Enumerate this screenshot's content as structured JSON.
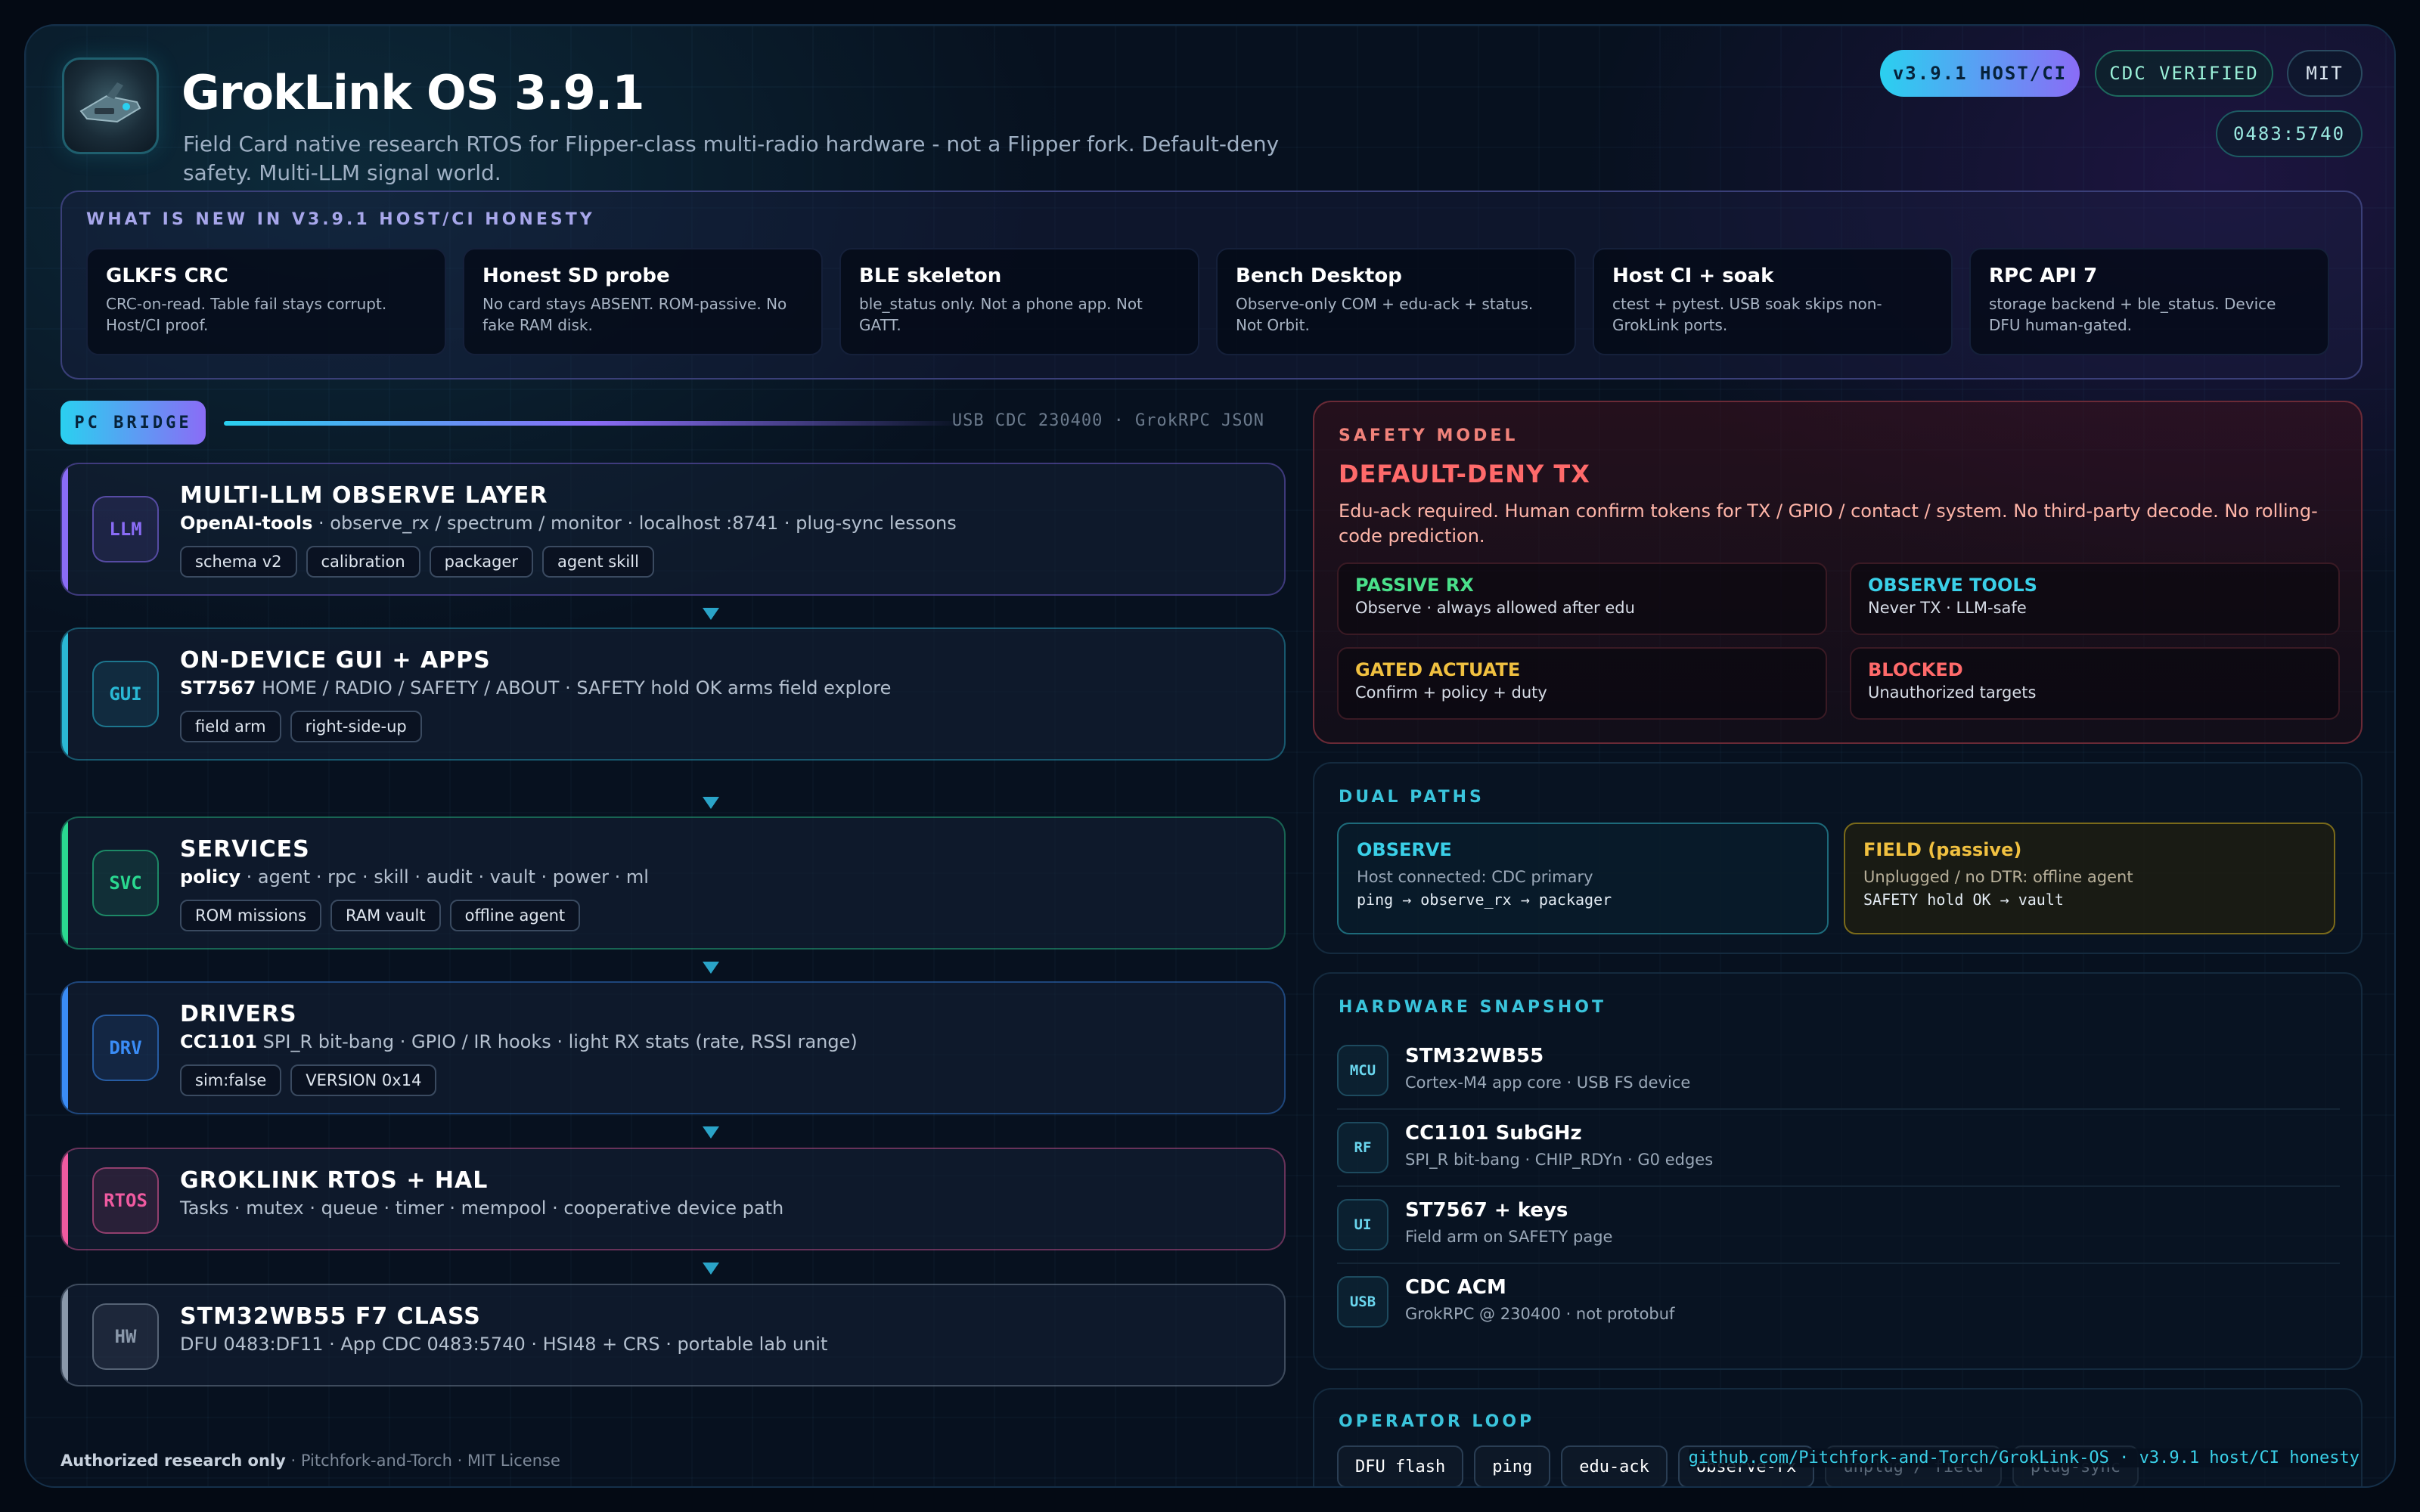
{
  "header": {
    "title": "GrokLink OS 3.9.1",
    "subtitle": "Field Card native research RTOS for Flipper-class multi-radio hardware - not a Flipper fork. Default-deny safety. Multi-LLM signal world.",
    "badges": {
      "version": "v3.9.1 HOST/CI",
      "cdc": "CDC VERIFIED",
      "license": "MIT",
      "usb_id": "0483:5740"
    }
  },
  "whats_new": {
    "label": "WHAT IS NEW IN V3.9.1 HOST/CI HONESTY",
    "cards": [
      {
        "title": "GLKFS CRC",
        "text": "CRC-on-read. Table fail stays corrupt. Host/CI proof."
      },
      {
        "title": "Honest SD probe",
        "text": "No card stays ABSENT. ROM-passive. No fake RAM disk."
      },
      {
        "title": "BLE skeleton",
        "text": "ble_status only. Not a phone app. Not GATT."
      },
      {
        "title": "Bench Desktop",
        "text": "Observe-only COM + edu-ack + status. Not Orbit."
      },
      {
        "title": "Host CI + soak",
        "text": "ctest + pytest. USB soak skips non-GrokLink ports."
      },
      {
        "title": "RPC API 7",
        "text": "storage backend + ble_status. Device DFU human-gated."
      }
    ]
  },
  "pc_bridge": {
    "label": "PC BRIDGE",
    "info": "USB CDC 230400 · GrokRPC JSON"
  },
  "layers": [
    {
      "chip": "LLM",
      "title": "MULTI-LLM OBSERVE LAYER",
      "desc_bold": "OpenAI-tools",
      "desc": " · observe_rx / spectrum / monitor · localhost :8741 · plug-sync lessons",
      "tags": [
        "schema v2",
        "calibration",
        "packager",
        "agent skill"
      ],
      "color": "#8a6cf6"
    },
    {
      "chip": "GUI",
      "title": "ON-DEVICE GUI + APPS",
      "desc_bold": "ST7567",
      "desc": " HOME / RADIO / SAFETY / ABOUT · SAFETY hold OK arms field explore",
      "tags": [
        "field arm",
        "right-side-up"
      ],
      "color": "#2ab8d4"
    },
    {
      "chip": "SVC",
      "title": "SERVICES",
      "desc_bold": "policy",
      "desc": " · agent · rpc · skill · audit · vault · power · ml",
      "tags": [
        "ROM missions",
        "RAM vault",
        "offline agent"
      ],
      "color": "#2ad890"
    },
    {
      "chip": "DRV",
      "title": "DRIVERS",
      "desc_bold": "CC1101",
      "desc": " SPI_R bit-bang · GPIO / IR hooks · light RX stats (rate, RSSI range)",
      "tags": [
        "sim:false",
        "VERSION 0x14"
      ],
      "color": "#3a8cf6"
    },
    {
      "chip": "RTOS",
      "title": "GROKLINK RTOS + HAL",
      "desc_bold": "",
      "desc": "Tasks · mutex · queue · timer · mempool · cooperative device path",
      "tags": [],
      "color": "#f05aa0"
    },
    {
      "chip": "HW",
      "title": "STM32WB55 F7 CLASS",
      "desc_bold": "",
      "desc": "DFU 0483:DF11 · App CDC 0483:5740 · HSI48 + CRS · portable lab unit",
      "tags": [],
      "color": "#8a98aa"
    }
  ],
  "safety": {
    "label": "SAFETY MODEL",
    "heading": "DEFAULT-DENY TX",
    "body": "Edu-ack required. Human confirm tokens for TX / GPIO / contact / system. No third-party decode. No rolling-code prediction.",
    "cells": [
      {
        "title": "PASSIVE RX",
        "text": "Observe · always allowed after edu",
        "color": "#4ae08a"
      },
      {
        "title": "OBSERVE TOOLS",
        "text": "Never TX · LLM-safe",
        "color": "#3ad0e8"
      },
      {
        "title": "GATED ACTUATE",
        "text": "Confirm + policy + duty",
        "color": "#f0c040"
      },
      {
        "title": "BLOCKED",
        "text": "Unauthorized targets",
        "color": "#ff6a6a"
      }
    ]
  },
  "dual_paths": {
    "label": "DUAL PATHS",
    "observe": {
      "title": "OBSERVE",
      "text": "Host connected: CDC primary",
      "code": "ping → observe_rx → packager"
    },
    "field": {
      "title": "FIELD (passive)",
      "text": "Unplugged / no DTR: offline agent",
      "code": "SAFETY hold OK → vault"
    }
  },
  "hardware": {
    "label": "HARDWARE SNAPSHOT",
    "rows": [
      {
        "icon": "MCU",
        "title": "STM32WB55",
        "text": "Cortex-M4 app core · USB FS device"
      },
      {
        "icon": "RF",
        "title": "CC1101 SubGHz",
        "text": "SPI_R bit-bang · CHIP_RDYn · G0 edges"
      },
      {
        "icon": "UI",
        "title": "ST7567 + keys",
        "text": "Field arm on SAFETY page"
      },
      {
        "icon": "USB",
        "title": "CDC ACM",
        "text": "GrokRPC @ 230400 · not protobuf"
      }
    ]
  },
  "operator_loop": {
    "label": "OPERATOR LOOP",
    "steps": [
      "DFU flash",
      "ping",
      "edu-ack",
      "observe-rx",
      "unplug / field",
      "plug-sync"
    ]
  },
  "footer": {
    "bold": "Authorized research only",
    "rest": " · Pitchfork-and-Torch · MIT License",
    "right": "github.com/Pitchfork-and-Torch/GrokLink-OS · v3.9.1 host/CI honesty"
  }
}
